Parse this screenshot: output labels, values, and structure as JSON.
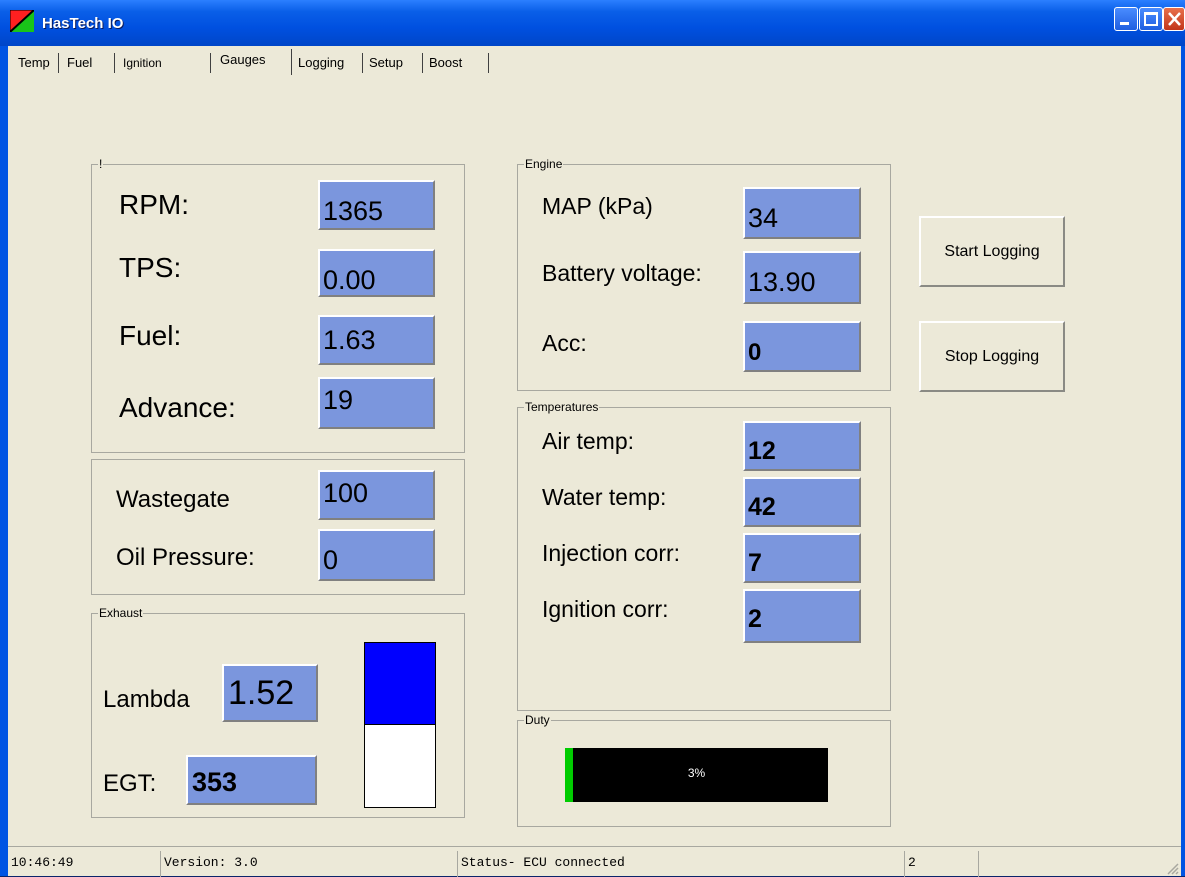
{
  "window": {
    "title": "HasTech IO"
  },
  "tabs": [
    {
      "label": "Temp"
    },
    {
      "label": "Fuel"
    },
    {
      "label": "Ignition"
    },
    {
      "label": "Gauges"
    },
    {
      "label": "Logging"
    },
    {
      "label": "Setup"
    },
    {
      "label": "Boost"
    }
  ],
  "main_group": {
    "title": "!"
  },
  "rpm": {
    "label": "RPM:",
    "value": "1365"
  },
  "tps": {
    "label": "TPS:",
    "value": "0.00"
  },
  "fuel": {
    "label": "Fuel:",
    "value": "1.63"
  },
  "advance": {
    "label": "Advance:",
    "value": "19"
  },
  "wastegate": {
    "label": "Wastegate",
    "value": "100"
  },
  "oil_pressure": {
    "label": "Oil Pressure:",
    "value": "0"
  },
  "exhaust": {
    "title": "Exhaust",
    "lambda_label": "Lambda",
    "lambda_value": "1.52",
    "egt_label": "EGT:",
    "egt_value": "353",
    "bar_fill_fraction": 0.5,
    "bar_color": "#0000ff"
  },
  "engine": {
    "title": "Engine",
    "map_label": "MAP (kPa)",
    "map_value": "34",
    "battery_label": "Battery voltage:",
    "battery_value": "13.90",
    "acc_label": "Acc:",
    "acc_value": "0"
  },
  "temperatures": {
    "title": "Temperatures",
    "air_label": "Air temp:",
    "air_value": "12",
    "water_label": "Water temp:",
    "water_value": "42",
    "inj_label": "Injection corr:",
    "inj_value": "7",
    "ign_label": "Ignition corr:",
    "ign_value": "2"
  },
  "duty": {
    "title": "Duty",
    "text": "3%",
    "value_fraction": 0.03
  },
  "buttons": {
    "start": "Start Logging",
    "stop": "Stop Logging"
  },
  "status": {
    "time": "10:46:49",
    "version": "Version: 3.0",
    "status": "Status- ECU connected",
    "count": "2"
  },
  "colors": {
    "field": "#7b96dd",
    "window_bg": "#ece9d8",
    "duty_fill": "#00cc00"
  }
}
